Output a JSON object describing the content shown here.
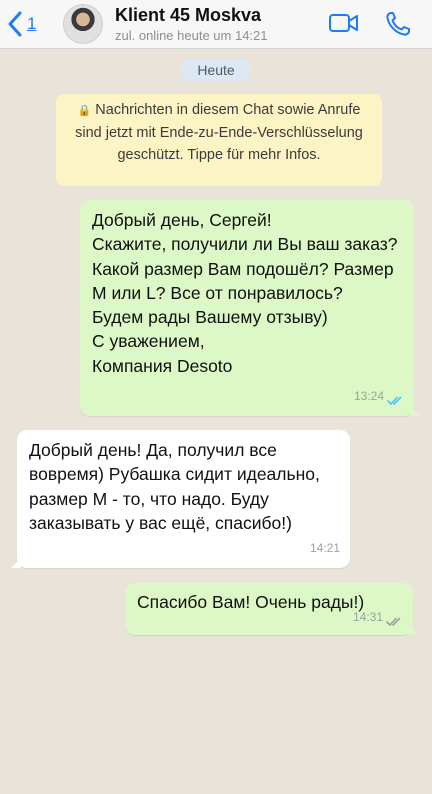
{
  "header": {
    "back_count": "1",
    "contact_name": "Klient 45 Moskva",
    "status": "zul. online heute um 14:21",
    "accent_color": "#1f7bf2"
  },
  "chat": {
    "day_label": "Heute",
    "encryption_notice": "Nachrichten in diesem Chat sowie Anrufe sind jetzt mit Ende-zu-Ende-Verschlüsselung geschützt. Tippe für mehr Infos.",
    "messages": [
      {
        "direction": "outgoing",
        "text": "Добрый день, Сергей!\nСкажите, получили ли Вы ваш заказ? Какой размер Вам подошёл? Размер M или L? Все от понравилось?\nБудем рады Вашему отзыву)\nС уважением,\nКомпания Desoto",
        "time": "13:24",
        "status_icon": "double-check-icon"
      },
      {
        "direction": "incoming",
        "text": "Добрый день! Да, получил все вовремя) Рубашка сидит идеально, размер M - то, что надо. Буду заказывать у вас ещё, спасибо!)",
        "time": "14:21"
      },
      {
        "direction": "outgoing",
        "text": "Спасибо Вам! Очень рады!)",
        "time": "14:31",
        "status_icon": "double-check-icon"
      }
    ]
  }
}
